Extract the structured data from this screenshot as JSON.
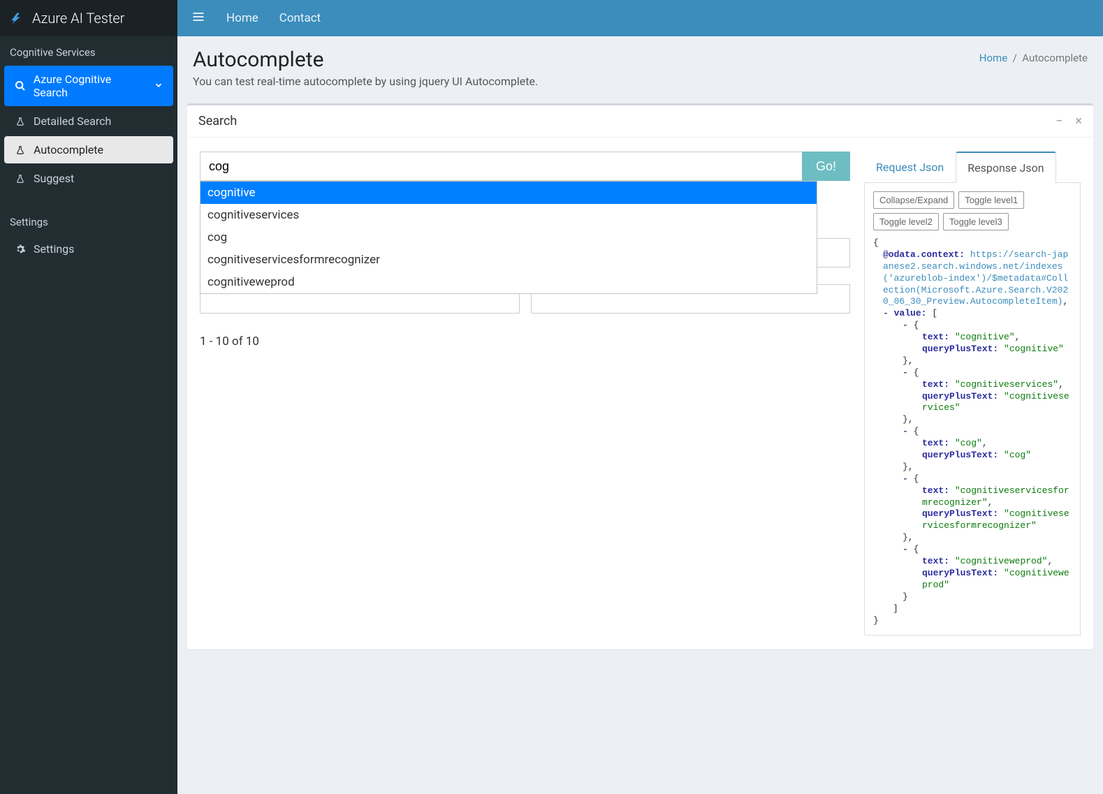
{
  "app": {
    "title": "Azure AI Tester"
  },
  "sidebar": {
    "section1": "Cognitive Services",
    "items1": [
      {
        "label": "Azure Cognitive Search"
      },
      {
        "label": "Detailed Search"
      },
      {
        "label": "Autocomplete"
      },
      {
        "label": "Suggest"
      }
    ],
    "section2": "Settings",
    "items2": [
      {
        "label": "Settings"
      }
    ]
  },
  "topnav": {
    "home": "Home",
    "contact": "Contact"
  },
  "page": {
    "title": "Autocomplete",
    "subtitle": "You can test real-time autocomplete by using jquery UI Autocomplete.",
    "crumb_home": "Home",
    "crumb_sep": "/",
    "crumb_current": "Autocomplete"
  },
  "panel": {
    "title": "Search"
  },
  "search": {
    "value": "cog",
    "go": "Go!",
    "ac": [
      "cognitive",
      "cognitiveservices",
      "cog",
      "cognitiveservicesformrecognizer",
      "cognitiveweprod"
    ],
    "result_count": "1 - 10 of 10"
  },
  "tabs": {
    "request": "Request Json",
    "response": "Response Json"
  },
  "json_buttons": {
    "collapse": "Collapse/Expand",
    "l1": "Toggle level1",
    "l2": "Toggle level2",
    "l3": "Toggle level3"
  },
  "response_json": {
    "context_key": "@odata.context:",
    "context_val": "https://search-japanese2.search.windows.net/indexes('azureblob-index')/$metadata#Collection(Microsoft.Azure.Search.V2020_06_30_Preview.AutocompleteItem)",
    "value_key": "value:",
    "text_key": "text:",
    "qpt_key": "queryPlusText:",
    "items": [
      {
        "text": "cognitive",
        "qpt": "cognitive"
      },
      {
        "text": "cognitiveservices",
        "qpt": "cognitiveservices"
      },
      {
        "text": "cog",
        "qpt": "cog"
      },
      {
        "text": "cognitiveservicesformrecognizer",
        "qpt": "cognitiveservicesformrecognizer"
      },
      {
        "text": "cognitiveweprod",
        "qpt": "cognitiveweprod"
      }
    ]
  }
}
